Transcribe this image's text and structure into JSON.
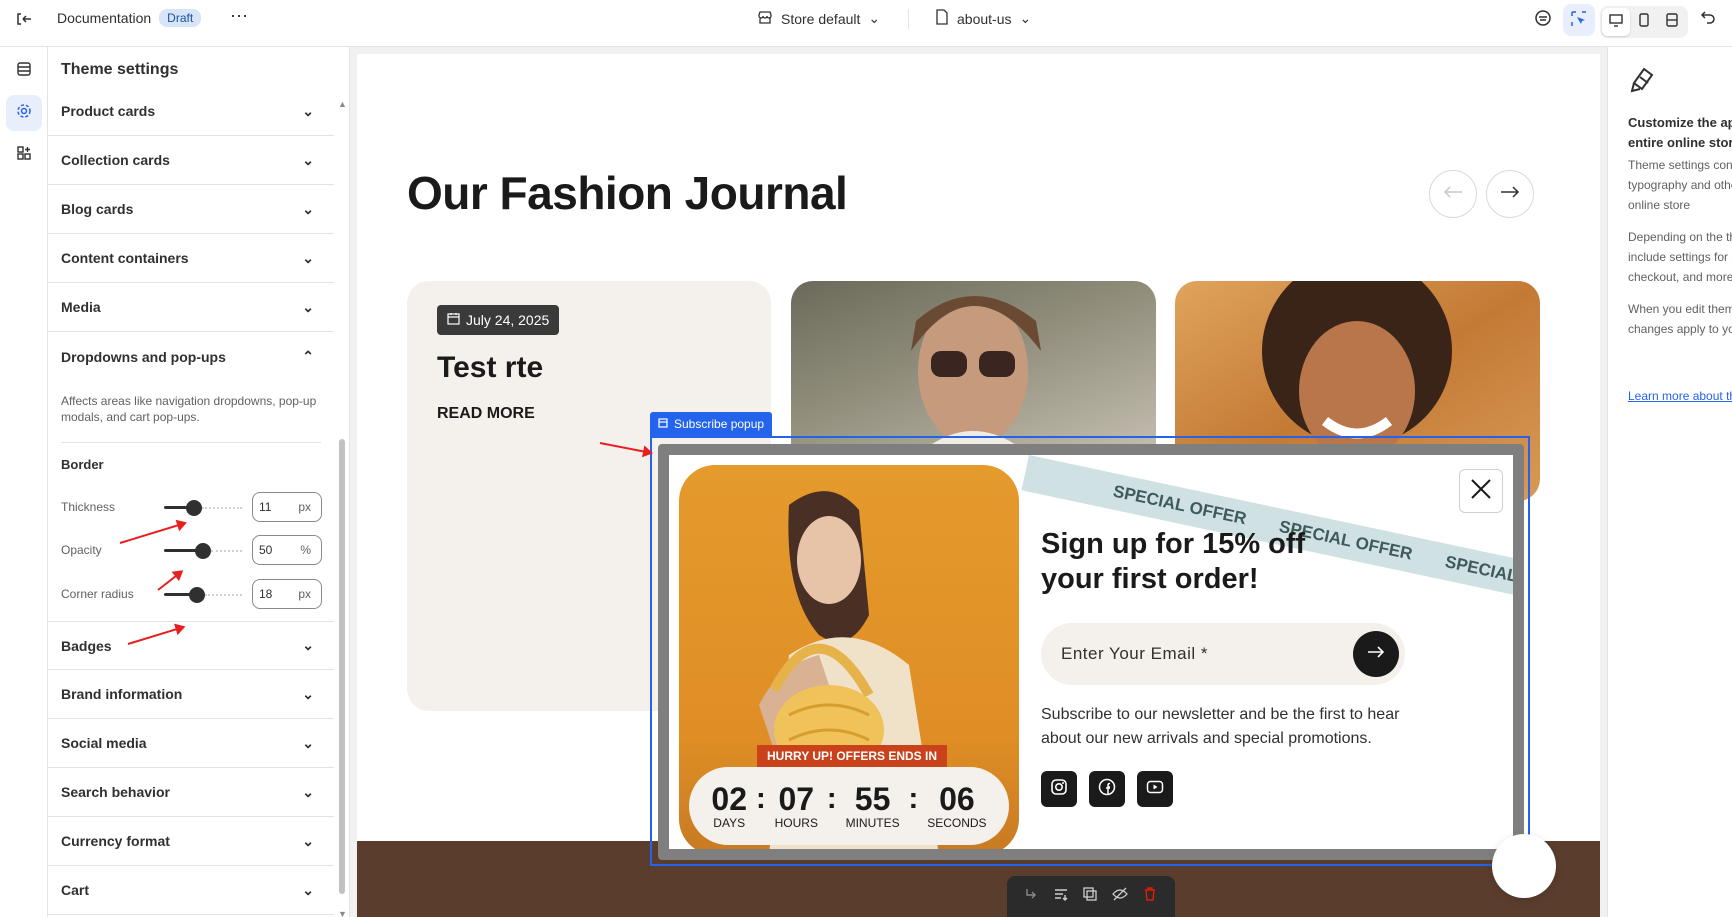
{
  "topbar": {
    "doc_label": "Documentation",
    "status_badge": "Draft",
    "store_selector": "Store default",
    "page_selector": "about-us"
  },
  "panel": {
    "title": "Theme settings",
    "sections_top": [
      "Product cards",
      "Collection cards",
      "Blog cards",
      "Content containers",
      "Media"
    ],
    "expanded_section": "Dropdowns and pop-ups",
    "expanded_desc": "Affects areas like navigation dropdowns, pop-up modals, and cart pop-ups.",
    "border_label": "Border",
    "thickness": {
      "label": "Thickness",
      "value": "11",
      "unit": "px",
      "level": 0.35
    },
    "opacity": {
      "label": "Opacity",
      "value": "50",
      "unit": "%",
      "level": 0.5
    },
    "corner_radius": {
      "label": "Corner radius",
      "value": "18",
      "unit": "px",
      "level": 0.4
    },
    "sections_bottom": [
      "Badges",
      "Brand information",
      "Social media",
      "Search behavior",
      "Currency format",
      "Cart"
    ]
  },
  "preview": {
    "journal_title": "Our Fashion Journal",
    "card": {
      "date": "July 24, 2025",
      "title": "Test rte",
      "read_more": "READ MORE"
    }
  },
  "popup": {
    "tag": "Subscribe popup",
    "ribbon_text": "SPECIAL OFFER",
    "heading": "Sign up for 15% off your first order!",
    "email_placeholder": "Enter Your Email *",
    "description": "Subscribe to our newsletter and be the first to hear about our new arrivals and special promotions.",
    "hurry_label": "HURRY UP! OFFERS ENDS IN",
    "countdown": [
      {
        "value": "02",
        "label": "DAYS"
      },
      {
        "value": "07",
        "label": "HOURS"
      },
      {
        "value": "55",
        "label": "MINUTES"
      },
      {
        "value": "06",
        "label": "SECONDS"
      }
    ],
    "social_icons": [
      "instagram-icon",
      "facebook-icon",
      "youtube-icon"
    ]
  },
  "right_panel": {
    "title": "Customize the appearance of your entire online store",
    "text1": "Theme settings control the colors, typography and other global parts of your online store",
    "text2": "Depending on the theme, this may include settings for social media links, checkout, and more.",
    "text3": "When you edit theme settings, the changes apply to your entire online store.",
    "link": "Learn more about theme settings"
  },
  "colors": {
    "accent": "#2463eb",
    "annotation": "#e81f1f",
    "promo": "#e59a2c"
  }
}
